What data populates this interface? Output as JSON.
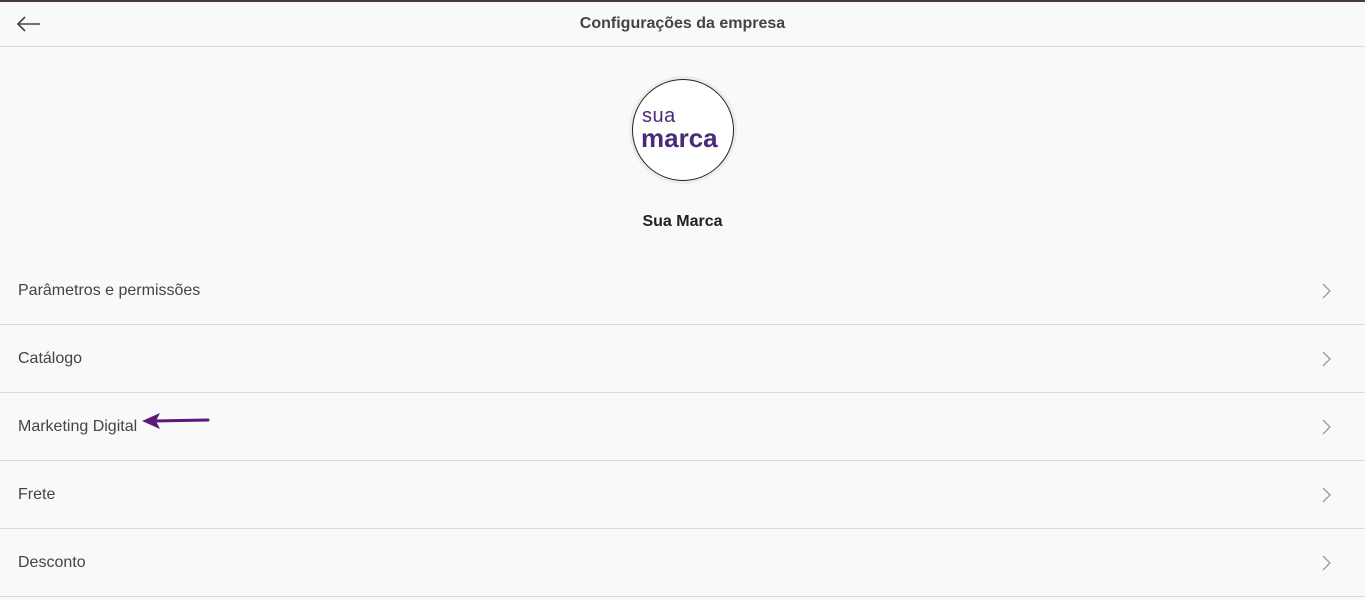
{
  "header": {
    "title": "Configurações da empresa",
    "back_icon": "arrow-left-icon"
  },
  "profile": {
    "logo": {
      "line1": "sua",
      "line2": "marca",
      "color": "#4a2a7a"
    },
    "company_name": "Sua Marca"
  },
  "menu": {
    "items": [
      {
        "label": "Parâmetros e permissões",
        "icon": "chevron-right-icon"
      },
      {
        "label": "Catálogo",
        "icon": "chevron-right-icon"
      },
      {
        "label": "Marketing Digital",
        "icon": "chevron-right-icon",
        "annotation": "purple-arrow"
      },
      {
        "label": "Frete",
        "icon": "chevron-right-icon"
      },
      {
        "label": "Desconto",
        "icon": "chevron-right-icon"
      }
    ]
  },
  "colors": {
    "annotation_arrow": "#5a1a7a",
    "divider": "#dcdcdc",
    "background": "#f9f9f9"
  }
}
